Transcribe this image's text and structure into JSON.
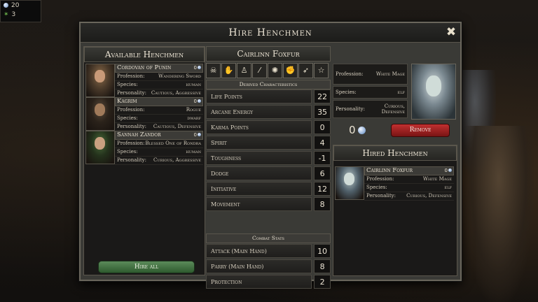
{
  "hud": {
    "gems": "20",
    "stars": "3"
  },
  "window": {
    "title": "Hire Henchmen"
  },
  "available": {
    "header": "Available Henchmen",
    "hire_all_label": "Hire all",
    "items": [
      {
        "name": "Cordovan of Punin",
        "cost": "0",
        "profession": "Wandering Sword",
        "species": "human",
        "personality": "Cautious, Aggressive"
      },
      {
        "name": "Kagrim",
        "cost": "0",
        "profession": "Rogue",
        "species": "dwarf",
        "personality": "Cautious, Defensive"
      },
      {
        "name": "Sannah Zandor",
        "cost": "0",
        "profession": "Blessed One of Rondra",
        "species": "human",
        "personality": "Curious, Aggressive"
      }
    ]
  },
  "labels": {
    "profession": "Profession:",
    "species": "Species:",
    "personality": "Personality:"
  },
  "selected": {
    "name": "Cairlinn Foxfur",
    "profession": "White Mage",
    "species": "elf",
    "personality": "Curious, Defensive",
    "cost": "0",
    "remove_label": "Remove"
  },
  "ability_icons": [
    "skull-icon",
    "hand-icon",
    "figure-icon",
    "wand-icon",
    "burst-icon",
    "fist-icon",
    "arrow-icon",
    "pentagram-icon"
  ],
  "derived": {
    "header": "Derived Characteristics",
    "stats": [
      {
        "label": "Life Points",
        "value": "22"
      },
      {
        "label": "Arcane Energy",
        "value": "35"
      },
      {
        "label": "Karma Points",
        "value": "0"
      },
      {
        "label": "Spirit",
        "value": "4"
      },
      {
        "label": "Toughness",
        "value": "-1"
      },
      {
        "label": "Dodge",
        "value": "6"
      },
      {
        "label": "Initiative",
        "value": "12"
      },
      {
        "label": "Movement",
        "value": "8"
      }
    ]
  },
  "combat": {
    "header": "Combat Stats",
    "stats": [
      {
        "label": "Attack (Main Hand)",
        "value": "10"
      },
      {
        "label": "Parry (Main Hand)",
        "value": "8"
      },
      {
        "label": "Protection",
        "value": "2"
      }
    ]
  },
  "hired": {
    "header": "Hired Henchmen",
    "items": [
      {
        "name": "Cairlinn Foxfur",
        "cost": "0",
        "profession": "White Mage",
        "species": "elf",
        "personality": "Curious, Defensive"
      }
    ]
  }
}
